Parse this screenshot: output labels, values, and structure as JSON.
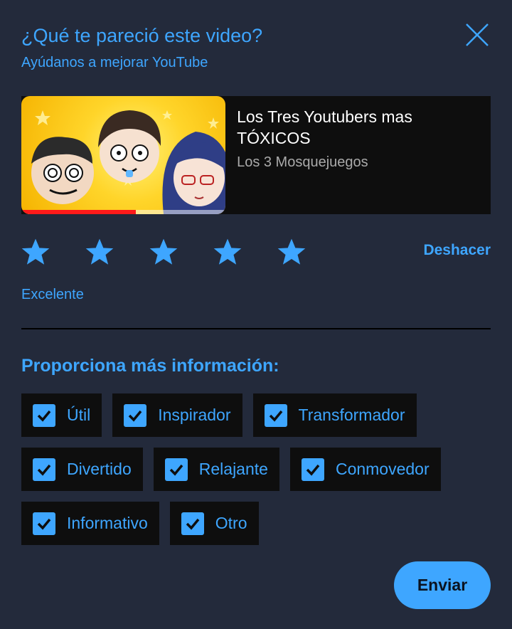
{
  "dialog": {
    "title": "¿Qué te pareció este video?",
    "subtitle": "Ayúdanos a mejorar YouTube",
    "close_icon": "close-icon"
  },
  "video": {
    "title": "Los Tres Youtubers mas TÓXICOS",
    "channel": "Los 3 Mosquejuegos",
    "watch_progress": 0.56,
    "thumbnail_icon": "video-thumbnail"
  },
  "rating": {
    "stars_filled": 5,
    "stars_total": 5,
    "star_icon": "star-icon",
    "label": "Excelente",
    "undo_label": "Deshacer"
  },
  "more_info": {
    "heading": "Proporciona más información:",
    "options": [
      {
        "label": "Útil",
        "checked": true
      },
      {
        "label": "Inspirador",
        "checked": true
      },
      {
        "label": "Transformador",
        "checked": true
      },
      {
        "label": "Divertido",
        "checked": true
      },
      {
        "label": "Relajante",
        "checked": true
      },
      {
        "label": "Conmovedor",
        "checked": true
      },
      {
        "label": "Informativo",
        "checked": true
      },
      {
        "label": "Otro",
        "checked": true
      }
    ]
  },
  "submit_label": "Enviar",
  "colors": {
    "background": "#232a3b",
    "accent": "#3ea6ff",
    "card": "#0e0e0e",
    "progress": "#ff1a1a"
  }
}
